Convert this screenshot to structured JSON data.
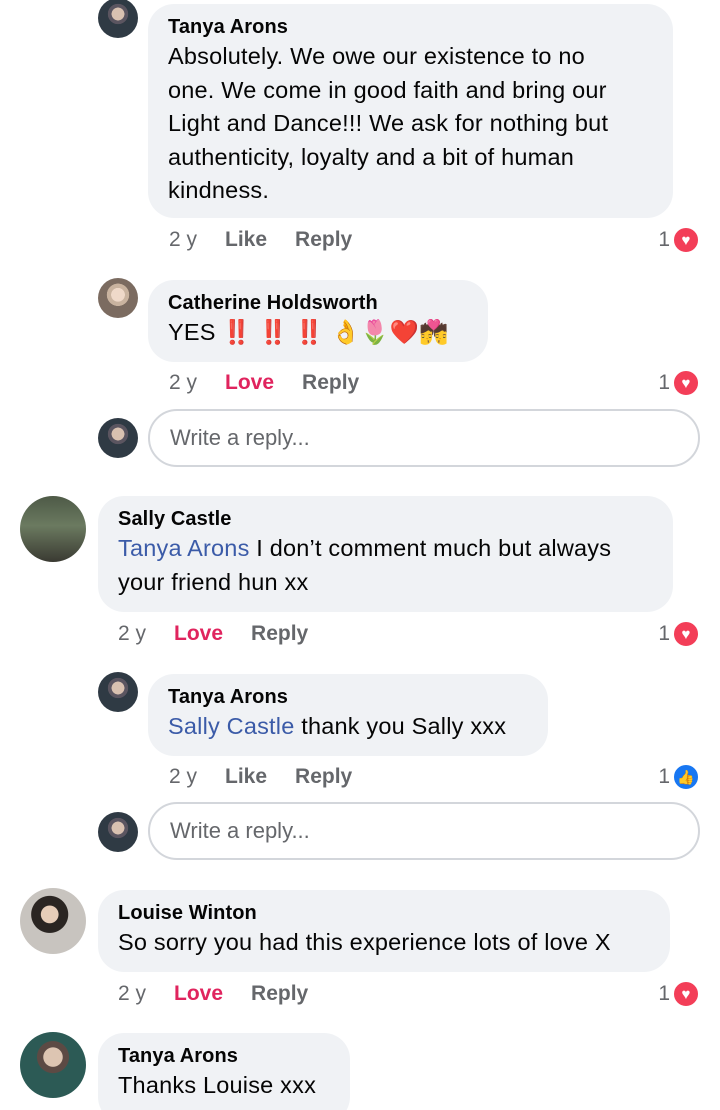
{
  "comments": [
    {
      "author": "Tanya Arons",
      "lines": [
        "Absolutely.  We owe our existence to no",
        "one.  We come in good faith and bring our",
        "Light and Dance!!! We ask for  nothing but",
        "authenticity, loyalty and a bit of human",
        "kindness."
      ],
      "time": "2 y",
      "action1": "Like",
      "action2": "Reply",
      "reaction_count": "1",
      "reaction_icon": "heart-icon"
    },
    {
      "author": "Catherine Holdsworth",
      "text": "YES",
      "emoji_marks": "‼️ ‼️ ‼️",
      "emoji_rest": "👌🌷❤️💏",
      "time": "2 y",
      "action1": "Love",
      "action2": "Reply",
      "reaction_count": "1",
      "reaction_icon": "heart-icon"
    },
    {
      "author": "Sally Castle",
      "mention": "Tanya Arons",
      "line1_rest": " I don’t comment much but always",
      "line2": "your friend hun xx",
      "time": "2 y",
      "action1": "Love",
      "action2": "Reply",
      "reaction_count": "1",
      "reaction_icon": "heart-icon"
    },
    {
      "author": "Tanya Arons",
      "mention": "Sally Castle",
      "text_rest": " thank you Sally xxx",
      "time": "2 y",
      "action1": "Like",
      "action2": "Reply",
      "reaction_count": "1",
      "reaction_icon": "like-icon"
    },
    {
      "author": "Louise Winton",
      "text": "So sorry you had this experience lots of love X",
      "time": "2 y",
      "action1": "Love",
      "action2": "Reply",
      "reaction_count": "1",
      "reaction_icon": "heart-icon"
    },
    {
      "author": "Tanya Arons",
      "text": "Thanks Louise xxx"
    }
  ],
  "reply_box": {
    "placeholder": "Write a reply..."
  },
  "colors": {
    "bubble": "#f0f2f5",
    "love": "#e0245e",
    "mention": "#3b5ba8",
    "heart": "#f33e58",
    "like": "#1877f2"
  }
}
